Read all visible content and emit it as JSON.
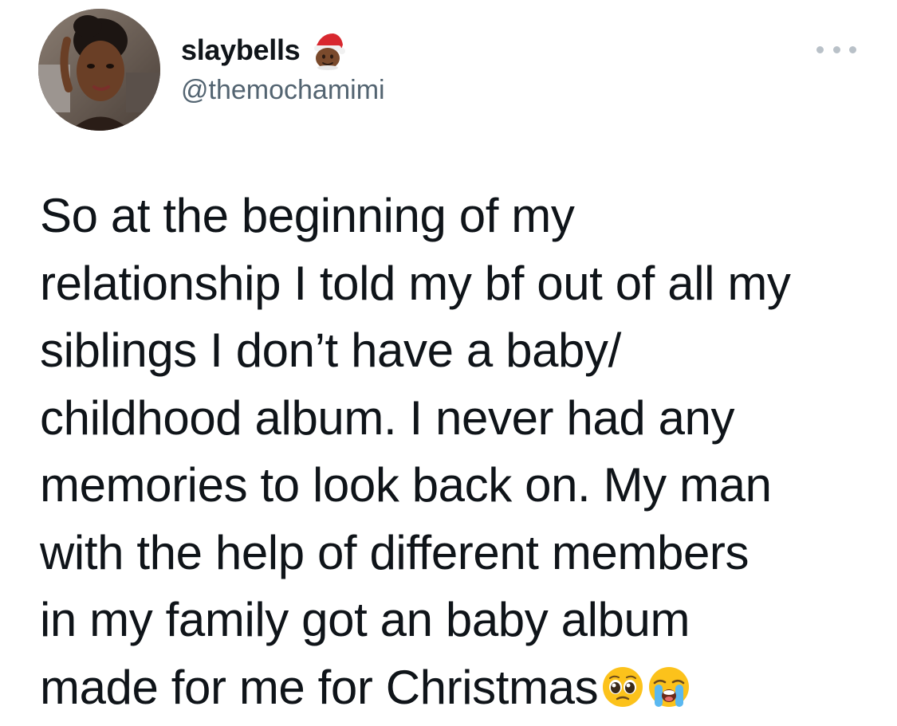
{
  "tweet": {
    "author": {
      "display_name": "slaybells",
      "name_emoji": "santa-emoji",
      "handle": "@themochamimi",
      "avatar": "avatar-photo"
    },
    "more_icon": "more-options-icon",
    "text_lines": [
      "So at the beginning of my",
      "relationship I told my bf out of all my",
      "siblings I don’t have a baby/",
      "childhood album. I never had any",
      "memories to look back on. My man",
      "with the help of different members",
      "in my family got an baby album",
      "made for me for Christmas"
    ],
    "trailing_emojis": [
      "pleading-face-emoji",
      "loudly-crying-face-emoji"
    ]
  }
}
